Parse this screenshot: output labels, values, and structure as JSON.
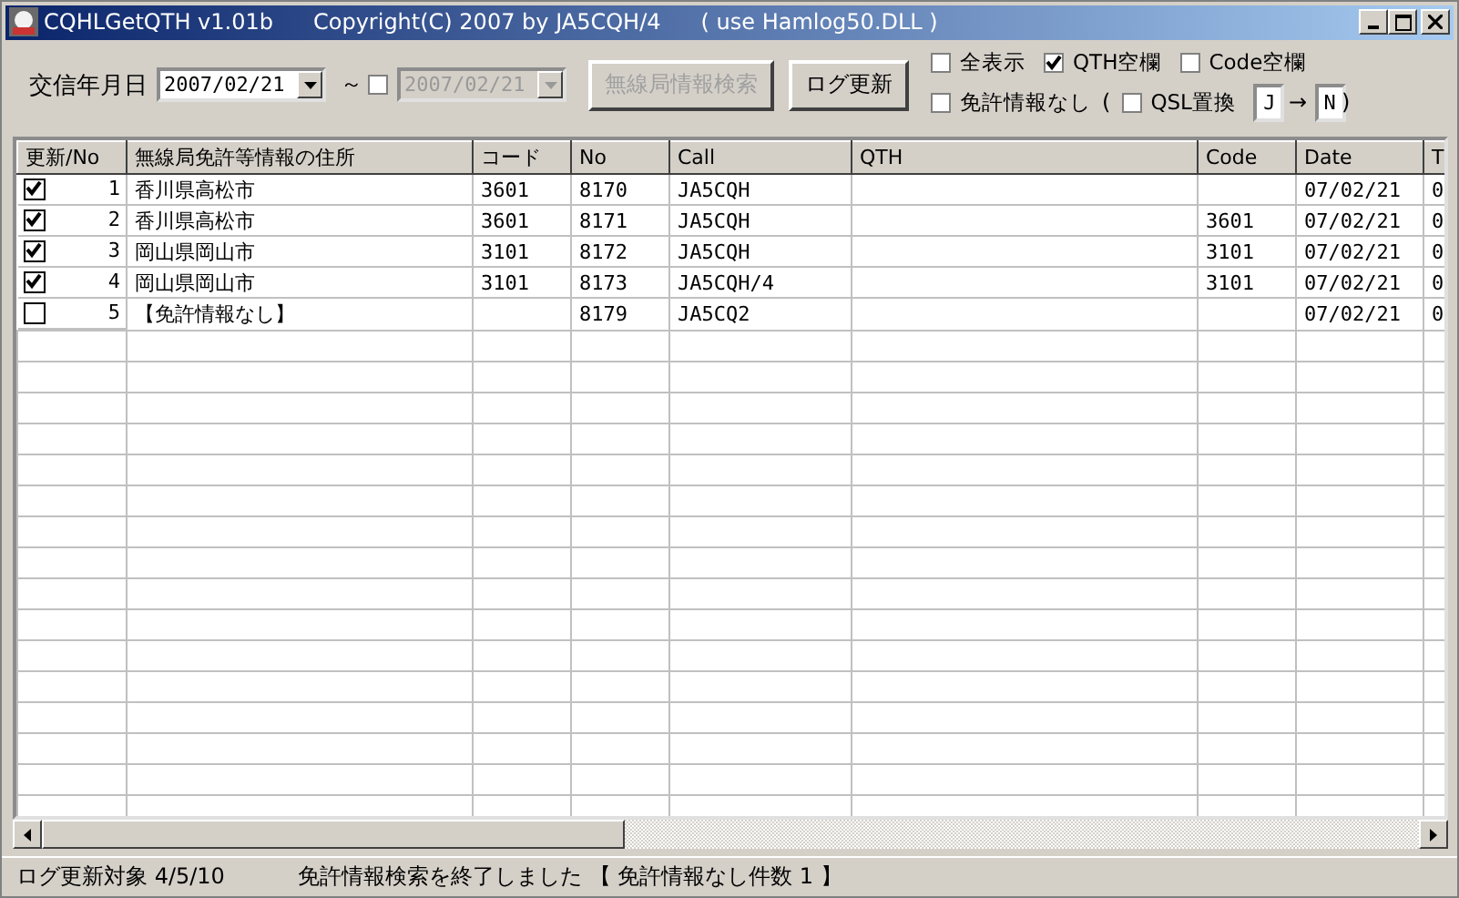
{
  "window": {
    "title": "CQHLGetQTH v1.01b",
    "copyright": "Copyright(C) 2007  by JA5CQH/4",
    "note": "( use Hamlog50.DLL )"
  },
  "toolbar": {
    "date_label": "交信年月日",
    "date_from": "2007/02/21",
    "tilde": "～",
    "date_to_enabled": false,
    "date_to": "2007/02/21",
    "buttons": [
      {
        "label": "無線局情報検索",
        "disabled": true
      },
      {
        "label": "ログ更新",
        "disabled": false
      }
    ],
    "options": [
      {
        "label": "全表示",
        "checked": false
      },
      {
        "label": "QTH空欄",
        "checked": true
      },
      {
        "label": "Code空欄",
        "checked": false
      },
      {
        "label": "免許情報なし",
        "checked": false
      }
    ],
    "open_paren": "(",
    "qsl_replace": {
      "label": "QSL置換",
      "checked": false,
      "from": "J",
      "arrow": "→",
      "to": "N"
    },
    "close_paren": ")"
  },
  "table": {
    "columns": [
      "更新/No",
      "無線局免許等情報の住所",
      "コード",
      "No",
      "Call",
      "QTH",
      "Code",
      "Date",
      "T"
    ],
    "rows": [
      {
        "checked": true,
        "no": "1",
        "address": "香川県高松市",
        "code": "3601",
        "log_no": "8170",
        "call": "JA5CQH",
        "qth": "",
        "code_2": "",
        "date": "07/02/21",
        "t": "0"
      },
      {
        "checked": true,
        "no": "2",
        "address": "香川県高松市",
        "code": "3601",
        "log_no": "8171",
        "call": "JA5CQH",
        "qth": "",
        "code_2": "3601",
        "date": "07/02/21",
        "t": "0"
      },
      {
        "checked": true,
        "no": "3",
        "address": "岡山県岡山市",
        "code": "3101",
        "log_no": "8172",
        "call": "JA5CQH",
        "qth": "",
        "code_2": "3101",
        "date": "07/02/21",
        "t": "0"
      },
      {
        "checked": true,
        "no": "4",
        "address": "岡山県岡山市",
        "code": "3101",
        "log_no": "8173",
        "call": "JA5CQH/4",
        "qth": "",
        "code_2": "3101",
        "date": "07/02/21",
        "t": "0"
      },
      {
        "checked": false,
        "no": "5",
        "address": "【免許情報なし】",
        "code": "",
        "log_no": "8179",
        "call": "JA5CQ2",
        "qth": "",
        "code_2": "",
        "date": "07/02/21",
        "t": "0"
      }
    ]
  },
  "status_bar": {
    "count": "ログ更新対象 4/5/10",
    "message": "免許情報検索を終了しました 【 免許情報なし件数 1 】"
  }
}
